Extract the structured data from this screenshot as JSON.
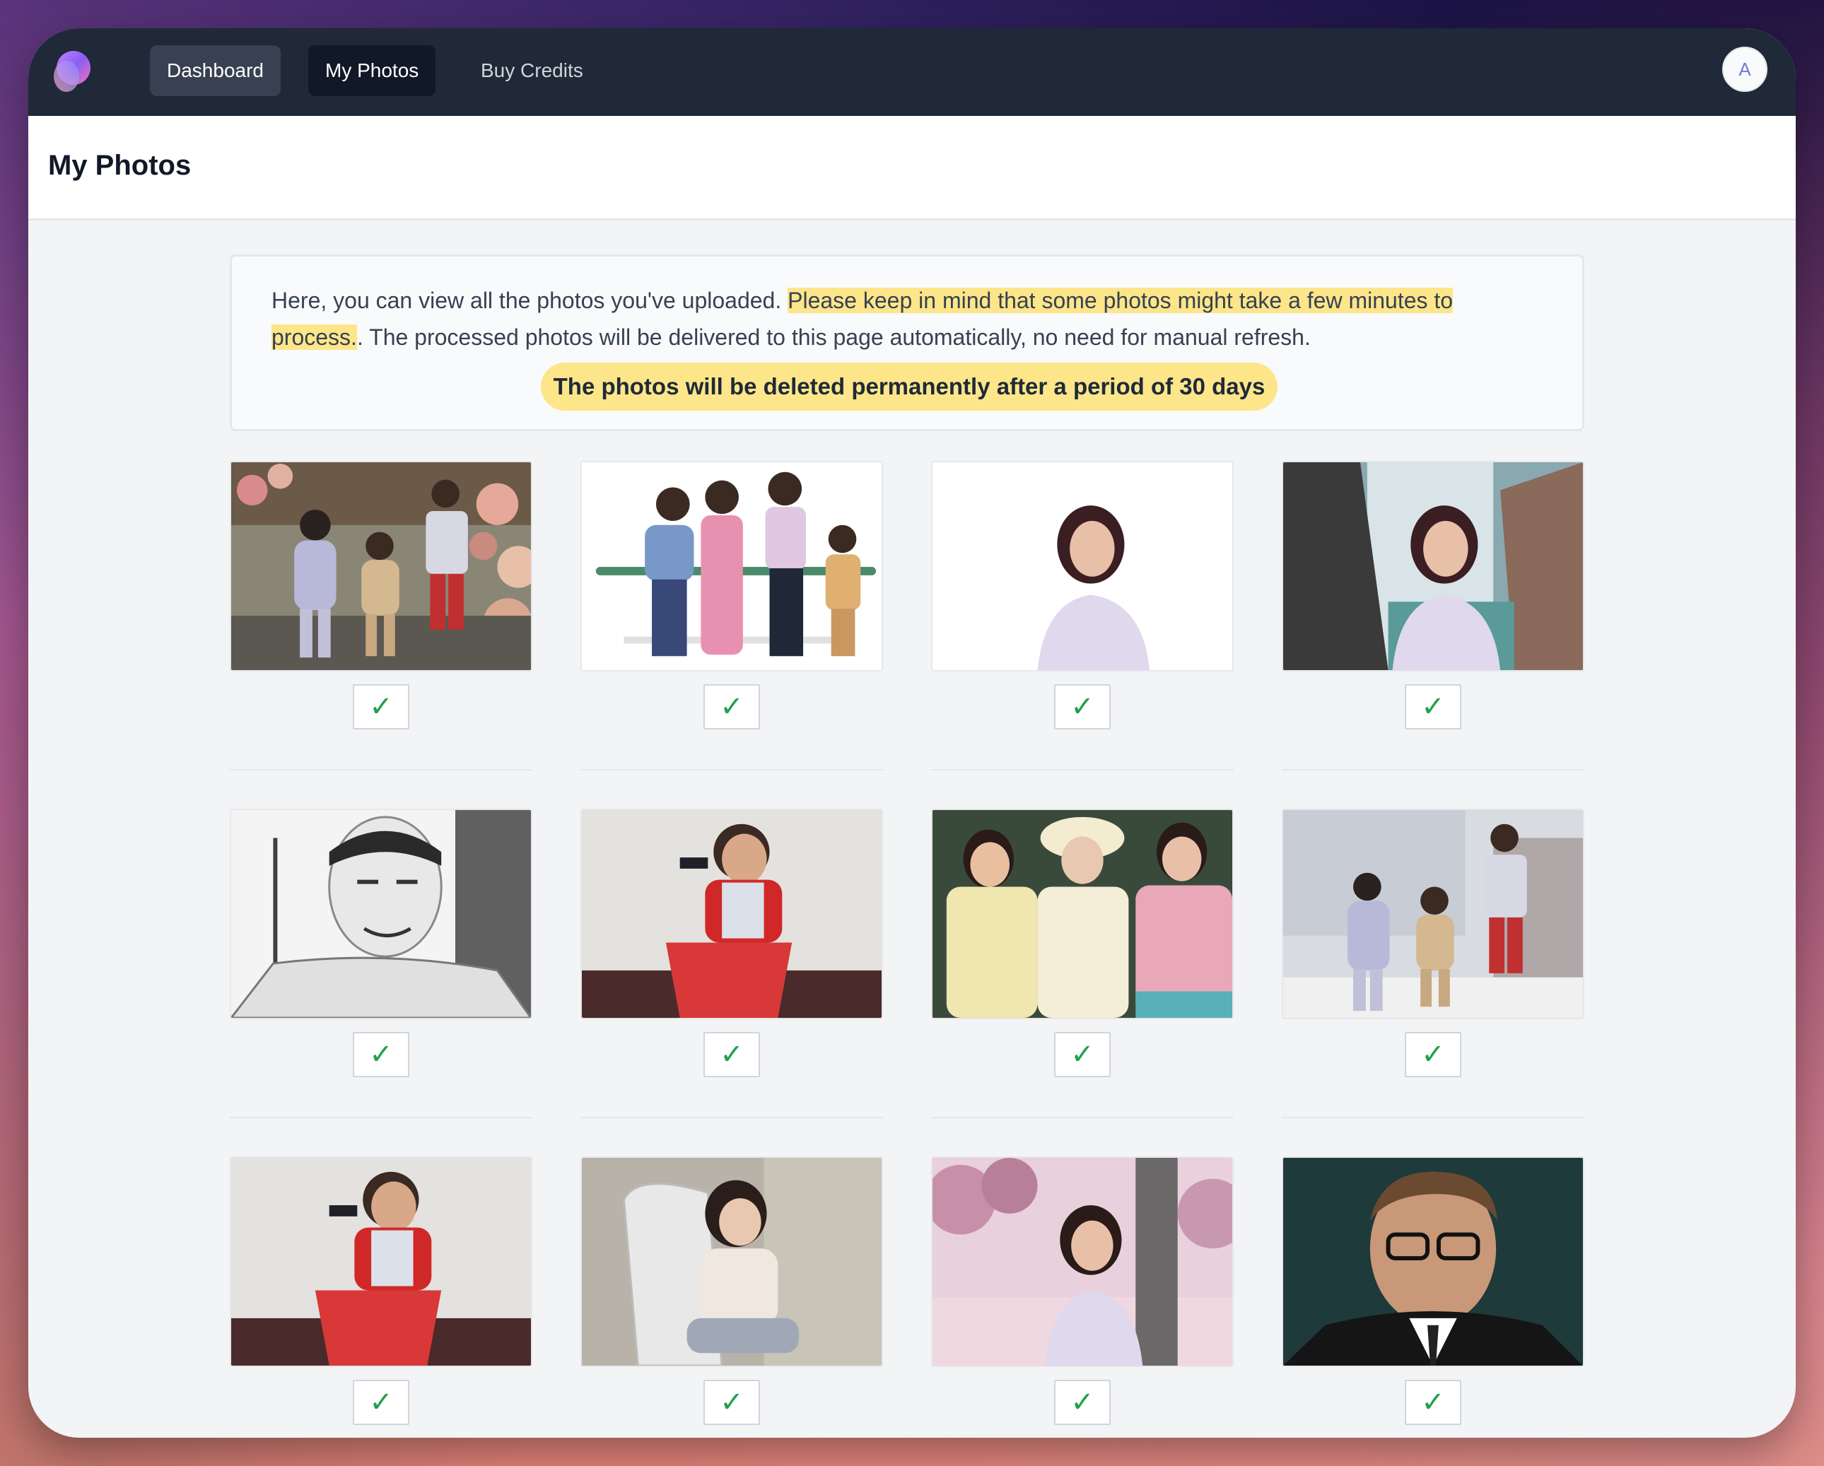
{
  "nav": {
    "logo_icon": "app-logo-icon",
    "items": [
      {
        "label": "Dashboard"
      },
      {
        "label": "My Photos"
      },
      {
        "label": "Buy Credits"
      }
    ],
    "avatar_initial": "A"
  },
  "header": {
    "title": "My Photos"
  },
  "notice": {
    "text_before": "Here, you can view all the photos you've uploaded. ",
    "highlight": "Please keep in mind that some photos might take a few minutes to process.",
    "text_after": ". The processed photos will be delivered to this page automatically, no need for manual refresh.",
    "warning": "The photos will be deleted permanently after a period of 30 days"
  },
  "photos": [
    {
      "status_icon": "check-icon",
      "status": "✓"
    },
    {
      "status_icon": "check-icon",
      "status": "✓"
    },
    {
      "status_icon": "check-icon",
      "status": "✓"
    },
    {
      "status_icon": "check-icon",
      "status": "✓"
    },
    {
      "status_icon": "check-icon",
      "status": "✓"
    },
    {
      "status_icon": "check-icon",
      "status": "✓"
    },
    {
      "status_icon": "check-icon",
      "status": "✓"
    },
    {
      "status_icon": "check-icon",
      "status": "✓"
    },
    {
      "status_icon": "check-icon",
      "status": "✓"
    },
    {
      "status_icon": "check-icon",
      "status": "✓"
    },
    {
      "status_icon": "check-icon",
      "status": "✓"
    },
    {
      "status_icon": "check-icon",
      "status": "✓"
    }
  ],
  "colors": {
    "topbar": "#1f2937",
    "highlight": "#fde68a",
    "check": "#22a04b"
  }
}
